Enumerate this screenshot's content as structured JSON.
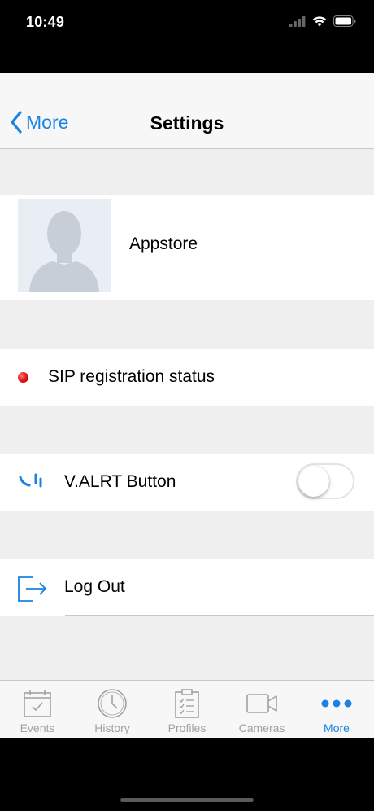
{
  "status_bar": {
    "time": "10:49"
  },
  "navbar": {
    "back_label": "More",
    "title": "Settings"
  },
  "profile": {
    "name": "Appstore"
  },
  "sip": {
    "label": "SIP registration status",
    "status_color": "#e01010"
  },
  "valrt": {
    "label": "V.ALRT Button",
    "enabled": false
  },
  "logout": {
    "label": "Log Out"
  },
  "tabbar": {
    "tabs": [
      {
        "label": "Events",
        "icon": "calendar-check-icon",
        "active": false
      },
      {
        "label": "History",
        "icon": "clock-icon",
        "active": false
      },
      {
        "label": "Profiles",
        "icon": "clipboard-checklist-icon",
        "active": false
      },
      {
        "label": "Cameras",
        "icon": "video-camera-icon",
        "active": false
      },
      {
        "label": "More",
        "icon": "more-dots-icon",
        "active": true
      }
    ]
  },
  "colors": {
    "accent": "#1a82e2",
    "inactive": "#a2a2a2",
    "group_background": "#efefef"
  }
}
